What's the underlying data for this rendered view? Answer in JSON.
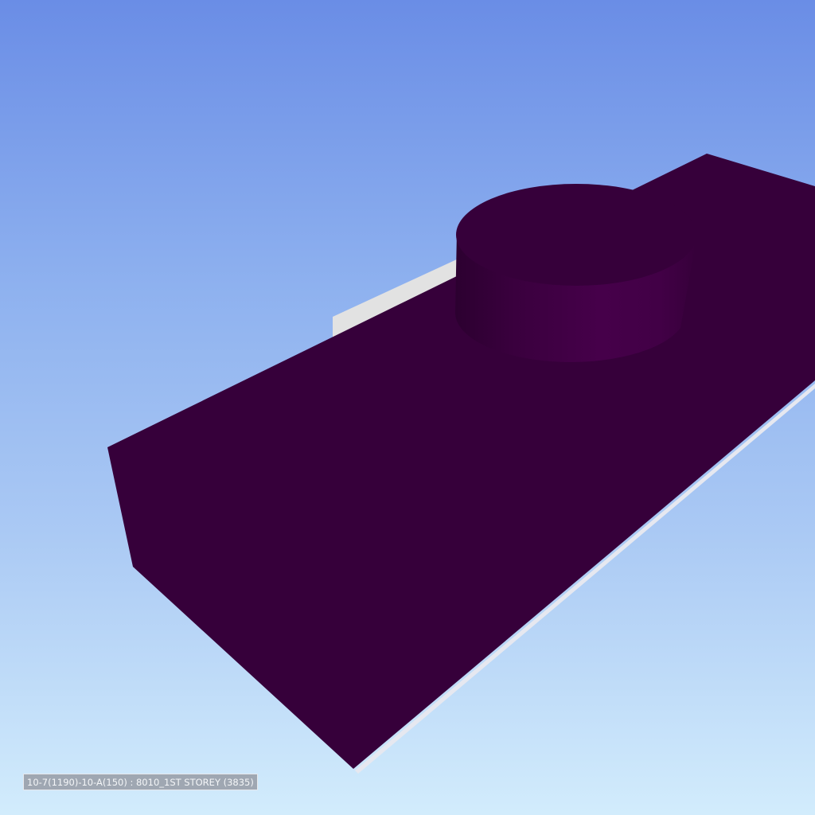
{
  "viewer": {
    "selection_label": "10-7(1190)-10-A(150) : 8010_1ST STOREY (3835)"
  },
  "colors": {
    "sky_top": "#6a8de6",
    "sky_bottom": "#d2ecfc",
    "slab": "#36003a",
    "cylinder_side": "#460048",
    "wall_panel": "#e2e2e2"
  }
}
